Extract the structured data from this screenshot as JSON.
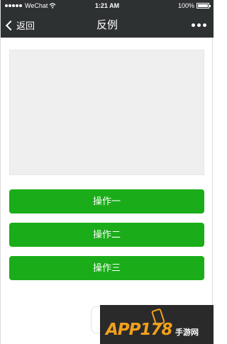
{
  "status_bar": {
    "carrier": "WeChat",
    "time": "1:21 AM",
    "battery": "100%"
  },
  "nav": {
    "back_label": "返回",
    "title": "反例"
  },
  "actions": [
    {
      "label": "操作一"
    },
    {
      "label": "操作二"
    },
    {
      "label": "操作三"
    }
  ],
  "watermark": {
    "brand": "APP178",
    "suffix": "手游网"
  },
  "colors": {
    "nav_bg": "#2e3132",
    "button_green": "#1aad19",
    "placeholder_gray": "#efefef",
    "watermark_orange": "#f2a01b"
  },
  "icons": [
    "signal-icon",
    "wifi-icon",
    "battery-icon",
    "chevron-left-icon",
    "more-dots-icon"
  ]
}
